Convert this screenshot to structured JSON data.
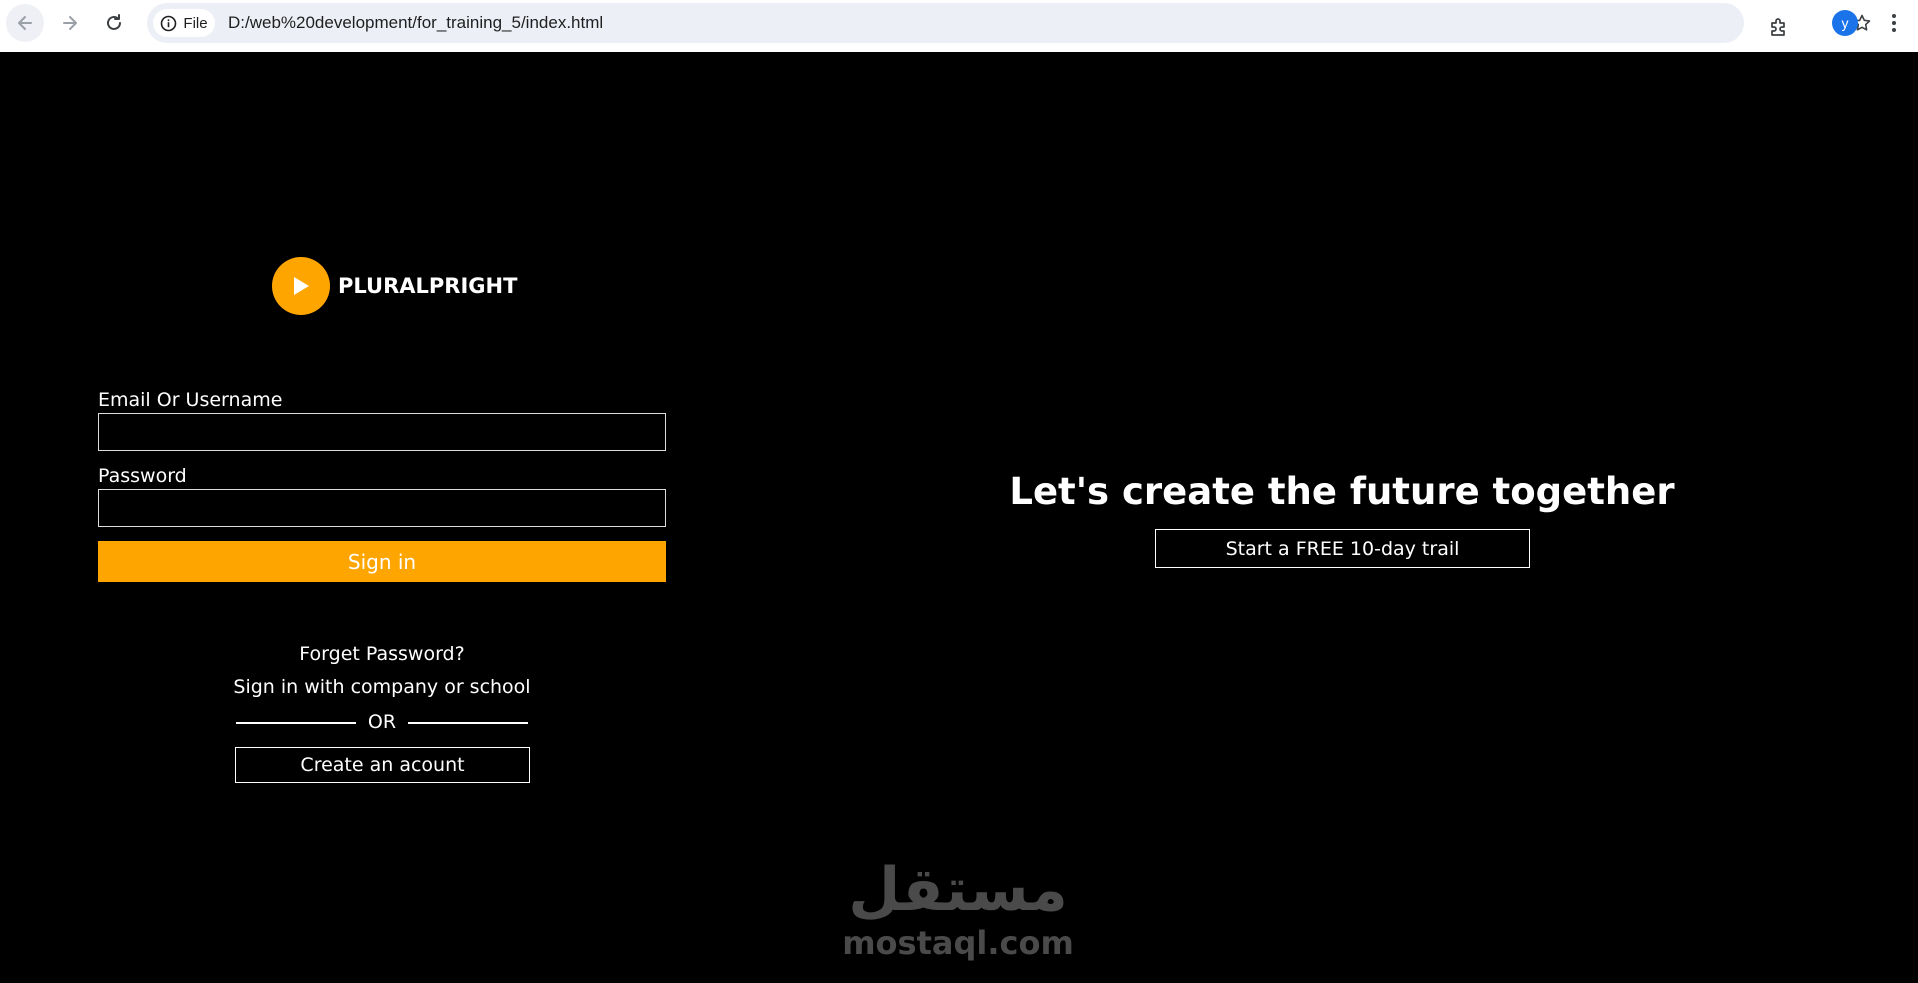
{
  "browser": {
    "site_chip": "File",
    "url": "D:/web%20development/for_training_5/index.html",
    "avatar_letter": "y",
    "icons": [
      "back-arrow-icon",
      "forward-arrow-icon",
      "reload-icon",
      "info-icon",
      "star-icon",
      "extensions-icon",
      "kebab-menu-icon"
    ]
  },
  "logo": {
    "text": "PLURALPRIGHT",
    "icon": "play-icon",
    "color": "#ffa500"
  },
  "login": {
    "email_label": "Email Or Username",
    "email_value": "",
    "password_label": "Password",
    "password_value": "",
    "signin_label": "Sign in",
    "forget_password": "Forget Password?",
    "company_signin": "Sign in with company or school",
    "or_text": "OR",
    "create_account": "Create an acount"
  },
  "hero": {
    "headline": "Let's create the future together",
    "trial_button": "Start a FREE 10-day trail"
  },
  "watermark": {
    "arabic": "مستقل",
    "latin": "mostaql.com"
  },
  "colors": {
    "accent": "#ffa500",
    "background": "#000000"
  }
}
